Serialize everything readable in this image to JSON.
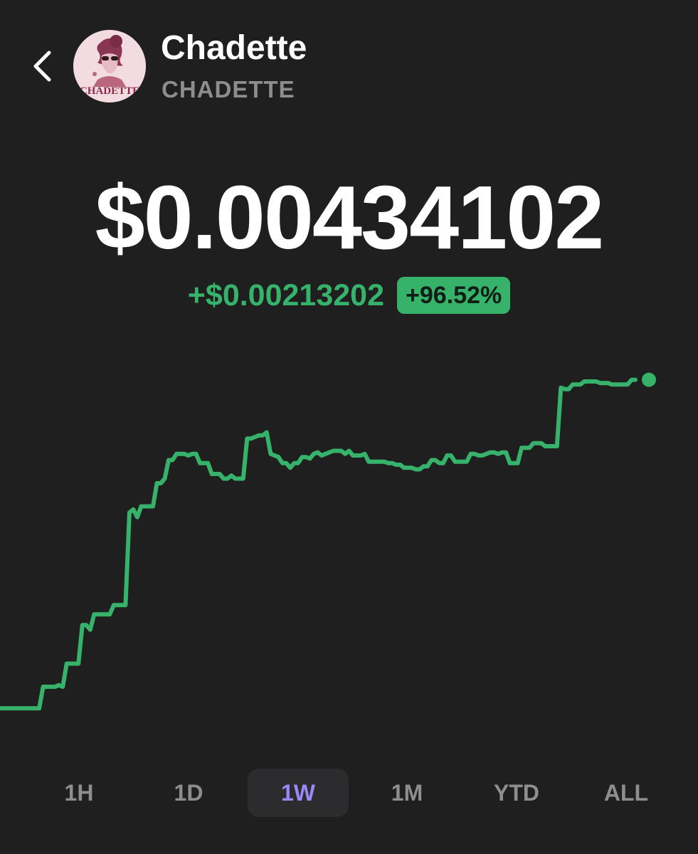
{
  "token": {
    "name": "Chadette",
    "symbol": "CHADETTE",
    "avatar_text": "CHADETTE"
  },
  "price": {
    "value": "$0.00434102",
    "change_abs": "+$0.00213202",
    "change_pct": "+96.52%"
  },
  "colors": {
    "background": "#1f1f1f",
    "positive": "#36b26b",
    "selected_range": "#9c88f6",
    "muted": "#8e8e8e"
  },
  "ranges": {
    "items": [
      "1H",
      "1D",
      "1W",
      "1M",
      "YTD",
      "ALL"
    ],
    "selected": "1W"
  },
  "chart_data": {
    "type": "line",
    "values": [
      0.00221,
      0.00221,
      0.00221,
      0.00221,
      0.00221,
      0.00221,
      0.00221,
      0.00221,
      0.00221,
      0.00221,
      0.00221,
      0.00235,
      0.00235,
      0.00235,
      0.00235,
      0.00236,
      0.00235,
      0.0025,
      0.0025,
      0.0025,
      0.0025,
      0.00275,
      0.00275,
      0.00272,
      0.00282,
      0.00282,
      0.00282,
      0.00282,
      0.00282,
      0.00288,
      0.00288,
      0.00288,
      0.00288,
      0.00348,
      0.0035,
      0.00345,
      0.00352,
      0.00352,
      0.00352,
      0.00352,
      0.00367,
      0.00367,
      0.0037,
      0.00382,
      0.00382,
      0.00386,
      0.00386,
      0.00386,
      0.00385,
      0.00386,
      0.00386,
      0.0038,
      0.0038,
      0.0038,
      0.00373,
      0.00373,
      0.00373,
      0.0037,
      0.0037,
      0.00372,
      0.0037,
      0.0037,
      0.0037,
      0.00396,
      0.00396,
      0.00397,
      0.00398,
      0.00398,
      0.004,
      0.00386,
      0.00385,
      0.00384,
      0.0038,
      0.0038,
      0.00377,
      0.0038,
      0.0038,
      0.00384,
      0.00384,
      0.00383,
      0.00386,
      0.00387,
      0.00385,
      0.00386,
      0.00387,
      0.00388,
      0.00388,
      0.00388,
      0.00386,
      0.00388,
      0.00385,
      0.00385,
      0.00385,
      0.00386,
      0.00381,
      0.00381,
      0.00381,
      0.00381,
      0.00381,
      0.0038,
      0.0038,
      0.00379,
      0.00379,
      0.00377,
      0.00377,
      0.00377,
      0.00376,
      0.00376,
      0.00378,
      0.00378,
      0.00382,
      0.00382,
      0.0038,
      0.0038,
      0.00385,
      0.00385,
      0.00381,
      0.00381,
      0.00381,
      0.00381,
      0.00386,
      0.00386,
      0.00385,
      0.00385,
      0.00386,
      0.00387,
      0.00387,
      0.00386,
      0.00387,
      0.00387,
      0.0038,
      0.0038,
      0.0038,
      0.0039,
      0.0039,
      0.0039,
      0.00393,
      0.00393,
      0.00393,
      0.00391,
      0.00391,
      0.00391,
      0.00391,
      0.00429,
      0.00428,
      0.00428,
      0.00431,
      0.00431,
      0.00431,
      0.00433,
      0.00433,
      0.00433,
      0.00433,
      0.00432,
      0.00432,
      0.00432,
      0.00431,
      0.00431,
      0.00431,
      0.00431,
      0.00431,
      0.00434,
      0.00434102
    ],
    "ylim": [
      0.00205,
      0.00445
    ],
    "color": "#36b26b",
    "grid": false,
    "end_marker": true
  }
}
